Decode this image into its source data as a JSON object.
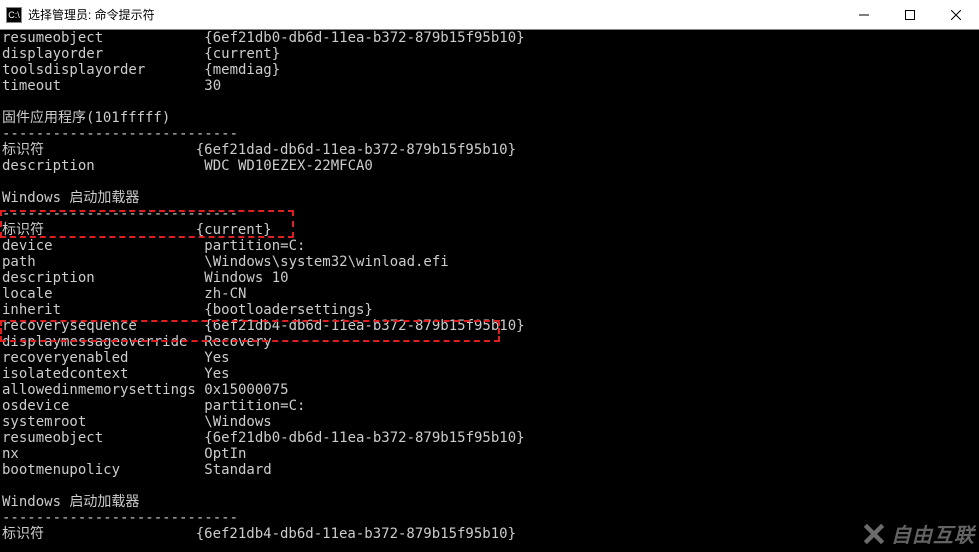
{
  "window": {
    "title": "选择管理员: 命令提示符",
    "icon_glyph": "C:\\"
  },
  "terminal": {
    "lines": [
      {
        "key": "resumeobject",
        "val": "{6ef21db0-db6d-11ea-b372-879b15f95b10}"
      },
      {
        "key": "displayorder",
        "val": "{current}"
      },
      {
        "key": "toolsdisplayorder",
        "val": "{memdiag}"
      },
      {
        "key": "timeout",
        "val": "30"
      },
      {
        "type": "blank"
      },
      {
        "type": "header",
        "text": "固件应用程序(101fffff)"
      },
      {
        "type": "divider"
      },
      {
        "key": "标识符",
        "val": "{6ef21dad-db6d-11ea-b372-879b15f95b10}"
      },
      {
        "key": "description",
        "val": "WDC WD10EZEX-22MFCA0"
      },
      {
        "type": "blank"
      },
      {
        "type": "header",
        "text": "Windows 启动加载器"
      },
      {
        "type": "divider"
      },
      {
        "key": "标识符",
        "val": "{current}"
      },
      {
        "key": "device",
        "val": "partition=C:"
      },
      {
        "key": "path",
        "val": "\\Windows\\system32\\winload.efi"
      },
      {
        "key": "description",
        "val": "Windows 10"
      },
      {
        "key": "locale",
        "val": "zh-CN"
      },
      {
        "key": "inherit",
        "val": "{bootloadersettings}"
      },
      {
        "key": "recoverysequence",
        "val": "{6ef21db4-db6d-11ea-b372-879b15f95b10}"
      },
      {
        "key": "displaymessageoverride",
        "val": "Recovery"
      },
      {
        "key": "recoveryenabled",
        "val": "Yes"
      },
      {
        "key": "isolatedcontext",
        "val": "Yes"
      },
      {
        "key": "allowedinmemorysettings",
        "val": "0x15000075"
      },
      {
        "key": "osdevice",
        "val": "partition=C:"
      },
      {
        "key": "systemroot",
        "val": "\\Windows"
      },
      {
        "key": "resumeobject",
        "val": "{6ef21db0-db6d-11ea-b372-879b15f95b10}"
      },
      {
        "key": "nx",
        "val": "OptIn"
      },
      {
        "key": "bootmenupolicy",
        "val": "Standard"
      },
      {
        "type": "blank"
      },
      {
        "type": "header",
        "text": "Windows 启动加载器"
      },
      {
        "type": "divider"
      },
      {
        "key": "标识符",
        "val": "{6ef21db4-db6d-11ea-b372-879b15f95b10}"
      }
    ]
  },
  "watermark_text": "自由互联"
}
